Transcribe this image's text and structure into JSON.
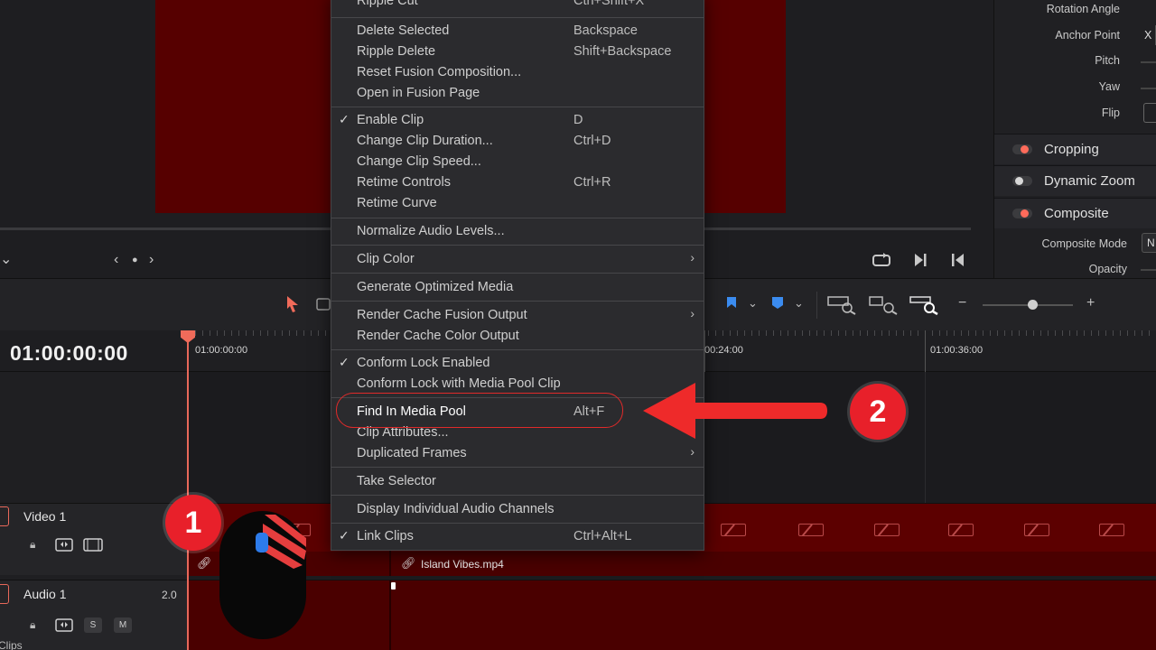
{
  "viewer": {
    "nav_prev": "‹",
    "nav_dot": "●",
    "nav_next": "›",
    "dropdown_chevron": "⌄"
  },
  "inspector": {
    "rows": [
      "Rotation Angle",
      "Anchor Point",
      "Pitch",
      "Yaw",
      "Flip"
    ],
    "anchor_x": "X",
    "sections": [
      "Cropping",
      "Dynamic Zoom",
      "Composite"
    ],
    "composite_mode_label": "Composite Mode",
    "composite_mode_value": "N",
    "opacity_label": "Opacity"
  },
  "timeline": {
    "timecode": "01:00:00:00",
    "ruler_labels": [
      "01:00:00:00",
      "00:24:00",
      "01:00:36:00"
    ],
    "tracks": {
      "video_name": "Video 1",
      "audio_name": "Audio 1",
      "audio_level": "2.0",
      "solo_label": "S",
      "mute_label": "M",
      "clips_label": "Clips"
    },
    "clip_name": "Island Vibes.mp4"
  },
  "menu": {
    "items": [
      {
        "label": "Ripple Cut",
        "shortcut": "Ctrl+Shift+X",
        "check": "",
        "sub": ""
      },
      {
        "label": "Delete Selected",
        "shortcut": "Backspace",
        "check": "",
        "sub": ""
      },
      {
        "label": "Ripple Delete",
        "shortcut": "Shift+Backspace",
        "check": "",
        "sub": ""
      },
      {
        "label": "Reset Fusion Composition...",
        "shortcut": "",
        "check": "",
        "sub": ""
      },
      {
        "label": "Open in Fusion Page",
        "shortcut": "",
        "check": "",
        "sub": ""
      },
      {
        "label": "Enable Clip",
        "shortcut": "D",
        "check": "✓",
        "sub": ""
      },
      {
        "label": "Change Clip Duration...",
        "shortcut": "Ctrl+D",
        "check": "",
        "sub": ""
      },
      {
        "label": "Change Clip Speed...",
        "shortcut": "",
        "check": "",
        "sub": ""
      },
      {
        "label": "Retime Controls",
        "shortcut": "Ctrl+R",
        "check": "",
        "sub": ""
      },
      {
        "label": "Retime Curve",
        "shortcut": "",
        "check": "",
        "sub": ""
      },
      {
        "label": "Normalize Audio Levels...",
        "shortcut": "",
        "check": "",
        "sub": ""
      },
      {
        "label": "Clip Color",
        "shortcut": "",
        "check": "",
        "sub": "›"
      },
      {
        "label": "Generate Optimized Media",
        "shortcut": "",
        "check": "",
        "sub": ""
      },
      {
        "label": "Render Cache Fusion Output",
        "shortcut": "",
        "check": "",
        "sub": "›"
      },
      {
        "label": "Render Cache Color Output",
        "shortcut": "",
        "check": "",
        "sub": ""
      },
      {
        "label": "Conform Lock Enabled",
        "shortcut": "",
        "check": "✓",
        "sub": ""
      },
      {
        "label": "Conform Lock with Media Pool Clip",
        "shortcut": "",
        "check": "",
        "sub": ""
      },
      {
        "label": "Find In Media Pool",
        "shortcut": "Alt+F",
        "check": "",
        "sub": ""
      },
      {
        "label": "Clip Attributes...",
        "shortcut": "",
        "check": "",
        "sub": ""
      },
      {
        "label": "Duplicated Frames",
        "shortcut": "",
        "check": "",
        "sub": "›"
      },
      {
        "label": "Take Selector",
        "shortcut": "",
        "check": "",
        "sub": ""
      },
      {
        "label": "Display Individual Audio Channels",
        "shortcut": "",
        "check": "",
        "sub": ""
      },
      {
        "label": "Link Clips",
        "shortcut": "Ctrl+Alt+L",
        "check": "✓",
        "sub": ""
      }
    ]
  },
  "annotations": {
    "step1": "1",
    "step2": "2"
  },
  "colors": {
    "clip_red": "#5c0000",
    "playhead": "#e8685a",
    "annotation_red": "#e8202a",
    "marker_blue": "#3b8cf0"
  }
}
